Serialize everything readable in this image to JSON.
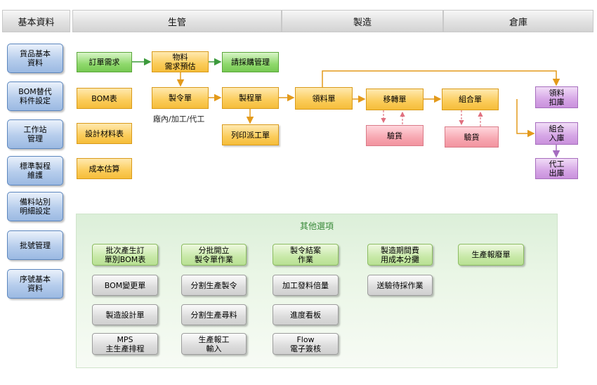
{
  "headers": {
    "basic": "基本資料",
    "production_mgmt": "生管",
    "manufacturing": "製造",
    "warehouse": "倉庫"
  },
  "sidebar": [
    "貨品基本\n資料",
    "BOM替代\n料件設定",
    "工作站\n管理",
    "標準製程\n維護",
    "備料站別\n明細設定",
    "批號管理",
    "序號基本\n資料"
  ],
  "flow": {
    "order_demand": "訂單需求",
    "material_demand": "物料\n需求預估",
    "purchase_request": "請採購管理",
    "bom_table": "BOM表",
    "work_order": "製令單",
    "routing_sheet": "製程單",
    "print_dispatch": "列印派工單",
    "work_order_note": "廠內/加工/代工",
    "design_bom": "設計材料表",
    "cost_estimate": "成本估算",
    "material_issue": "領料單",
    "transfer": "移轉單",
    "inspection_1": "驗貨",
    "assembly": "組合單",
    "inspection_2": "驗貨",
    "issue_deduct": "領料\n扣庫",
    "assembly_in": "組合\n入庫",
    "outsource_out": "代工\n出庫"
  },
  "other_options": {
    "title": "其他選項",
    "green_items": [
      "批次產生訂\n單別BOM表",
      "分批開立\n製令單作業",
      "製令結案\n作業",
      "製造期間費\n用成本分攤",
      "生產報廢單"
    ],
    "gray_items": [
      "BOM變更單",
      "分割生產製令",
      "加工發料倍量",
      "送驗待採作業",
      "製造設計單",
      "分割生產尋料",
      "進度看板",
      "MPS\n主生產排程",
      "生產報工\n輸入",
      "Flow\n電子簽核"
    ]
  }
}
